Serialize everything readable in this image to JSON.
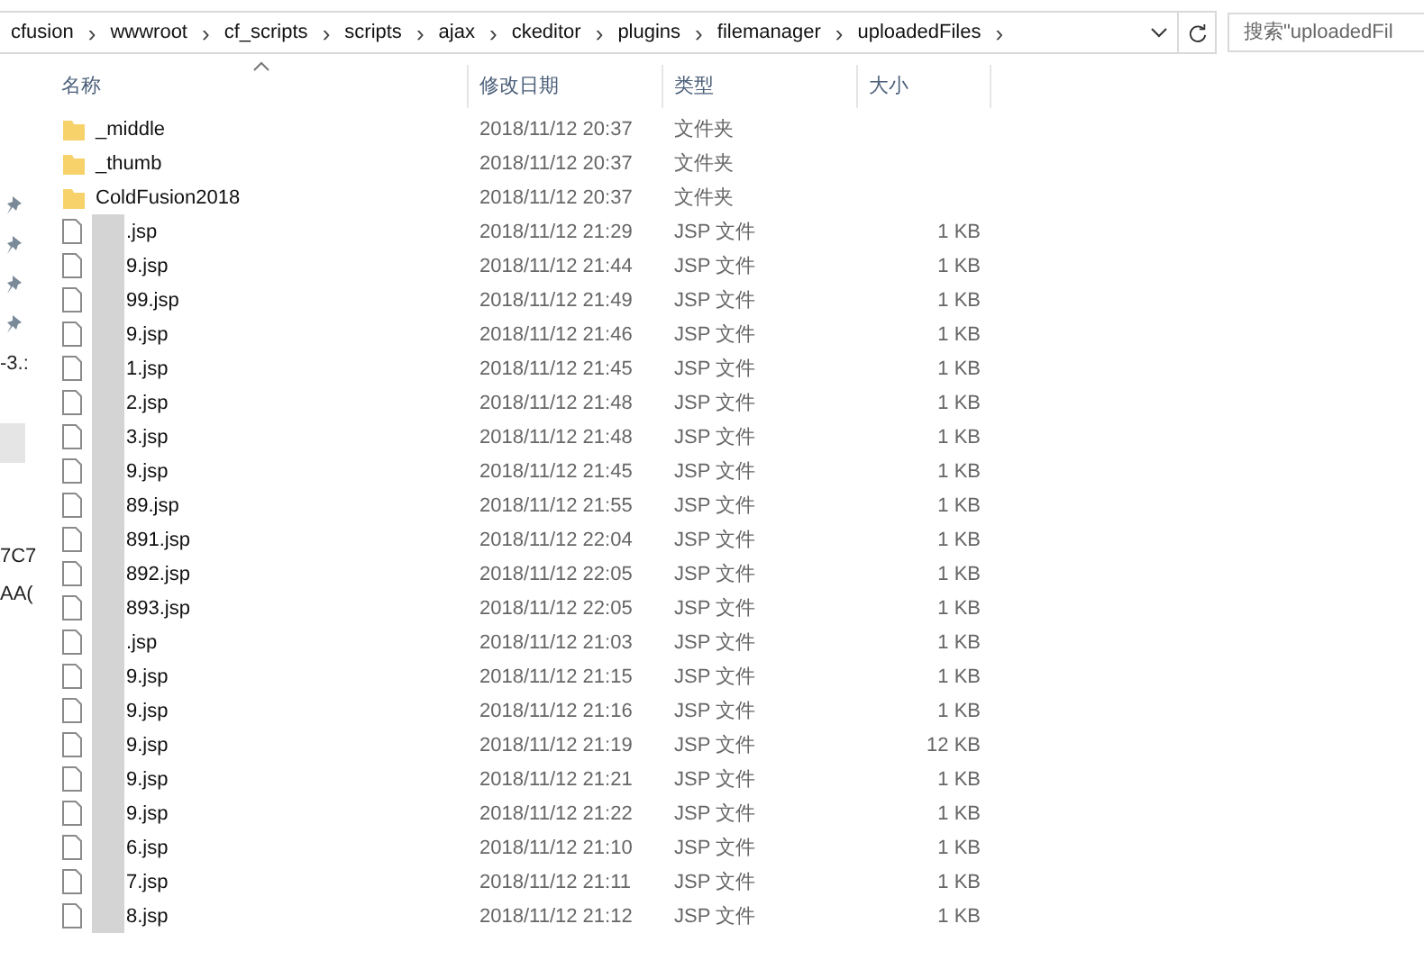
{
  "address_bar": {
    "crumbs": [
      "cfusion",
      "wwwroot",
      "cf_scripts",
      "scripts",
      "ajax",
      "ckeditor",
      "plugins",
      "filemanager",
      "uploadedFiles"
    ],
    "separator": "›"
  },
  "search": {
    "placeholder": "搜索\"uploadedFil"
  },
  "nav_pane": {
    "items": [
      {
        "kind": "pin"
      },
      {
        "kind": "pin"
      },
      {
        "kind": "pin"
      },
      {
        "kind": "pin"
      },
      {
        "kind": "text",
        "label": "-3.:"
      },
      {
        "kind": "block"
      },
      {
        "kind": "text",
        "label": "7C7"
      },
      {
        "kind": "text",
        "label": "AA("
      }
    ]
  },
  "columns": [
    "名称",
    "修改日期",
    "类型",
    "大小"
  ],
  "rows": [
    {
      "kind": "folder",
      "name": "_middle",
      "date": "2018/11/12 20:37",
      "type": "文件夹",
      "size": ""
    },
    {
      "kind": "folder",
      "name": "_thumb",
      "date": "2018/11/12 20:37",
      "type": "文件夹",
      "size": ""
    },
    {
      "kind": "folder",
      "name": "ColdFusion2018",
      "date": "2018/11/12 20:37",
      "type": "文件夹",
      "size": ""
    },
    {
      "kind": "file",
      "name": ".jsp",
      "date": "2018/11/12 21:29",
      "type": "JSP 文件",
      "size": "1 KB"
    },
    {
      "kind": "file",
      "name": "9.jsp",
      "date": "2018/11/12 21:44",
      "type": "JSP 文件",
      "size": "1 KB"
    },
    {
      "kind": "file",
      "name": "99.jsp",
      "date": "2018/11/12 21:49",
      "type": "JSP 文件",
      "size": "1 KB"
    },
    {
      "kind": "file",
      "name": "9.jsp",
      "date": "2018/11/12 21:46",
      "type": "JSP 文件",
      "size": "1 KB"
    },
    {
      "kind": "file",
      "name": "1.jsp",
      "date": "2018/11/12 21:45",
      "type": "JSP 文件",
      "size": "1 KB"
    },
    {
      "kind": "file",
      "name": "2.jsp",
      "date": "2018/11/12 21:48",
      "type": "JSP 文件",
      "size": "1 KB"
    },
    {
      "kind": "file",
      "name": "3.jsp",
      "date": "2018/11/12 21:48",
      "type": "JSP 文件",
      "size": "1 KB"
    },
    {
      "kind": "file",
      "name": "9.jsp",
      "date": "2018/11/12 21:45",
      "type": "JSP 文件",
      "size": "1 KB"
    },
    {
      "kind": "file",
      "name": "89.jsp",
      "date": "2018/11/12 21:55",
      "type": "JSP 文件",
      "size": "1 KB"
    },
    {
      "kind": "file",
      "name": "891.jsp",
      "date": "2018/11/12 22:04",
      "type": "JSP 文件",
      "size": "1 KB"
    },
    {
      "kind": "file",
      "name": "892.jsp",
      "date": "2018/11/12 22:05",
      "type": "JSP 文件",
      "size": "1 KB"
    },
    {
      "kind": "file",
      "name": "893.jsp",
      "date": "2018/11/12 22:05",
      "type": "JSP 文件",
      "size": "1 KB"
    },
    {
      "kind": "file",
      "name": ".jsp",
      "date": "2018/11/12 21:03",
      "type": "JSP 文件",
      "size": "1 KB"
    },
    {
      "kind": "file",
      "name": "9.jsp",
      "date": "2018/11/12 21:15",
      "type": "JSP 文件",
      "size": "1 KB"
    },
    {
      "kind": "file",
      "name": "9.jsp",
      "date": "2018/11/12 21:16",
      "type": "JSP 文件",
      "size": "1 KB"
    },
    {
      "kind": "file",
      "name": "9.jsp",
      "date": "2018/11/12 21:19",
      "type": "JSP 文件",
      "size": "12 KB"
    },
    {
      "kind": "file",
      "name": "9.jsp",
      "date": "2018/11/12 21:21",
      "type": "JSP 文件",
      "size": "1 KB"
    },
    {
      "kind": "file",
      "name": "9.jsp",
      "date": "2018/11/12 21:22",
      "type": "JSP 文件",
      "size": "1 KB"
    },
    {
      "kind": "file",
      "name": "6.jsp",
      "date": "2018/11/12 21:10",
      "type": "JSP 文件",
      "size": "1 KB"
    },
    {
      "kind": "file",
      "name": "7.jsp",
      "date": "2018/11/12 21:11",
      "type": "JSP 文件",
      "size": "1 KB"
    },
    {
      "kind": "file",
      "name": "8.jsp",
      "date": "2018/11/12 21:12",
      "type": "JSP 文件",
      "size": "1 KB"
    }
  ]
}
